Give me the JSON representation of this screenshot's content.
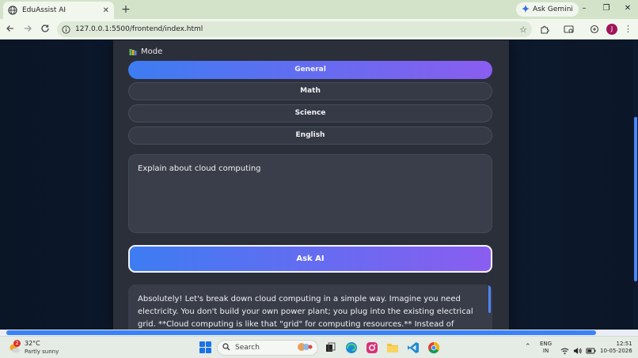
{
  "browser": {
    "tab_title": "EduAssist AI",
    "tab_close": "✕",
    "new_tab": "+",
    "ask_gemini": "Ask Gemini",
    "url": "127.0.0.1:5500/frontend/index.html",
    "profile_initial": "J",
    "window_minimize": "–",
    "window_restore": "❐",
    "window_close": "✕"
  },
  "app": {
    "mode_label": "Mode",
    "modes": [
      "General",
      "Math",
      "Science",
      "English"
    ],
    "active_mode": "General",
    "question_value": "Explain about cloud computing",
    "ask_button": "Ask AI",
    "answer_text": "Absolutely! Let's break down cloud computing in a simple way. Imagine you need electricity. You don't build your own power plant; you plug into the existing electrical grid. **Cloud computing is like that \"grid\" for computing resources.** Instead of owning and",
    "accent_start": "#3d7cf2",
    "accent_end": "#8a5df0"
  },
  "taskbar": {
    "temperature": "32°C",
    "condition": "Partly sunny",
    "weather_badge": "2",
    "search_placeholder": "Search",
    "lang_1": "ENG",
    "lang_2": "IN",
    "time": "12:51",
    "date": "10-05-2026"
  }
}
